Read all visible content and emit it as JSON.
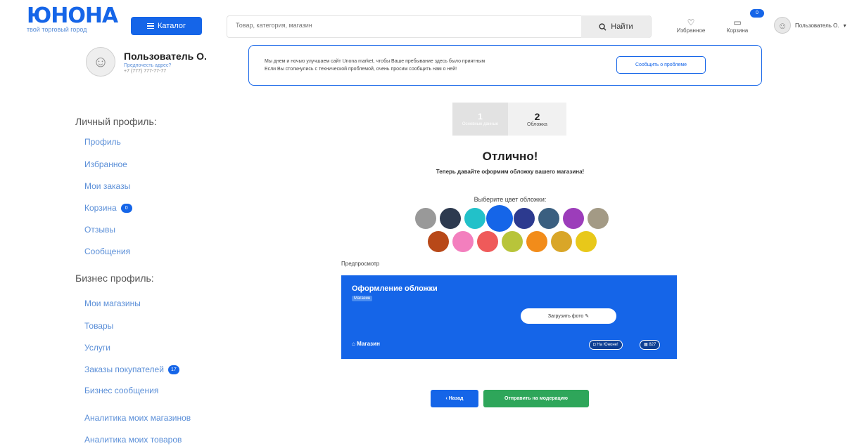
{
  "header": {
    "logo": "ЮНОНА",
    "logo_sub": "твой торговый город",
    "catalog_label": "Каталог",
    "search_placeholder": "Товар, категория, магазин",
    "search_button": "Найти",
    "favorites_label": "Избранное",
    "cart_label": "Корзина",
    "cart_count": "0",
    "user_label": "Пользователь О."
  },
  "profile": {
    "name": "Пользователь О.",
    "subtitle": "Предпочесть адрес?",
    "phone": "+7 (777) 777-77-77"
  },
  "notice": {
    "line1": "Мы днем и ночью улучшаем сайт Unona market, чтобы Ваше пребывание здесь было приятным",
    "line2": "Если Вы столкнулись с технической проблемой, очень просим сообщить нам о ней!",
    "button": "Сообщить о проблеме"
  },
  "sidebar": {
    "personal_title": "Личный профиль:",
    "personal_items": [
      {
        "label": "Профиль",
        "badge": ""
      },
      {
        "label": "Избранное",
        "badge": ""
      },
      {
        "label": "Мои заказы",
        "badge": ""
      },
      {
        "label": "Корзина",
        "badge": "0"
      },
      {
        "label": "Отзывы",
        "badge": ""
      },
      {
        "label": "Сообщения",
        "badge": ""
      }
    ],
    "business_title": "Бизнес профиль:",
    "business_items": [
      {
        "label": "Мои магазины",
        "badge": ""
      },
      {
        "label": "Товары",
        "badge": ""
      },
      {
        "label": "Услуги",
        "badge": ""
      },
      {
        "label": "Заказы покупателей",
        "badge": "17"
      },
      {
        "label": "Бизнес сообщения",
        "badge": ""
      },
      {
        "label": "Аналитика моих магазинов",
        "badge": ""
      },
      {
        "label": "Аналитика моих товаров",
        "badge": ""
      }
    ]
  },
  "steps": {
    "step1_number": "1",
    "step1_label": "Основные данные",
    "step2_number": "2",
    "step2_label": "Обложка"
  },
  "content": {
    "heading": "Отлично!",
    "subheading": "Теперь давайте оформим обложку вашего магазина!",
    "choose_color": "Выберите цвет обложки:",
    "preview_label": "Предпросмотр",
    "colors_row1": [
      "#999999",
      "#2d3a4f",
      "#22c1c9",
      "#1565e8",
      "#2c3a8f",
      "#3a5f80",
      "#9c3dba",
      "#a39a85"
    ],
    "colors_row2": [
      "#b84818",
      "#f37fbe",
      "#ef5a5a",
      "#b8c43a",
      "#f28c1a",
      "#d9a628",
      "#e8c81a"
    ],
    "selected_color": "#1565e8"
  },
  "cover": {
    "title": "Оформление обложки",
    "tag": "Магазин",
    "upload_button": "Загрузить фото",
    "shop_label": "Магазин",
    "pill1": "На Юноне!",
    "pill2": "827"
  },
  "actions": {
    "back": "‹ Назад",
    "send": "Отправить на модерацию"
  }
}
